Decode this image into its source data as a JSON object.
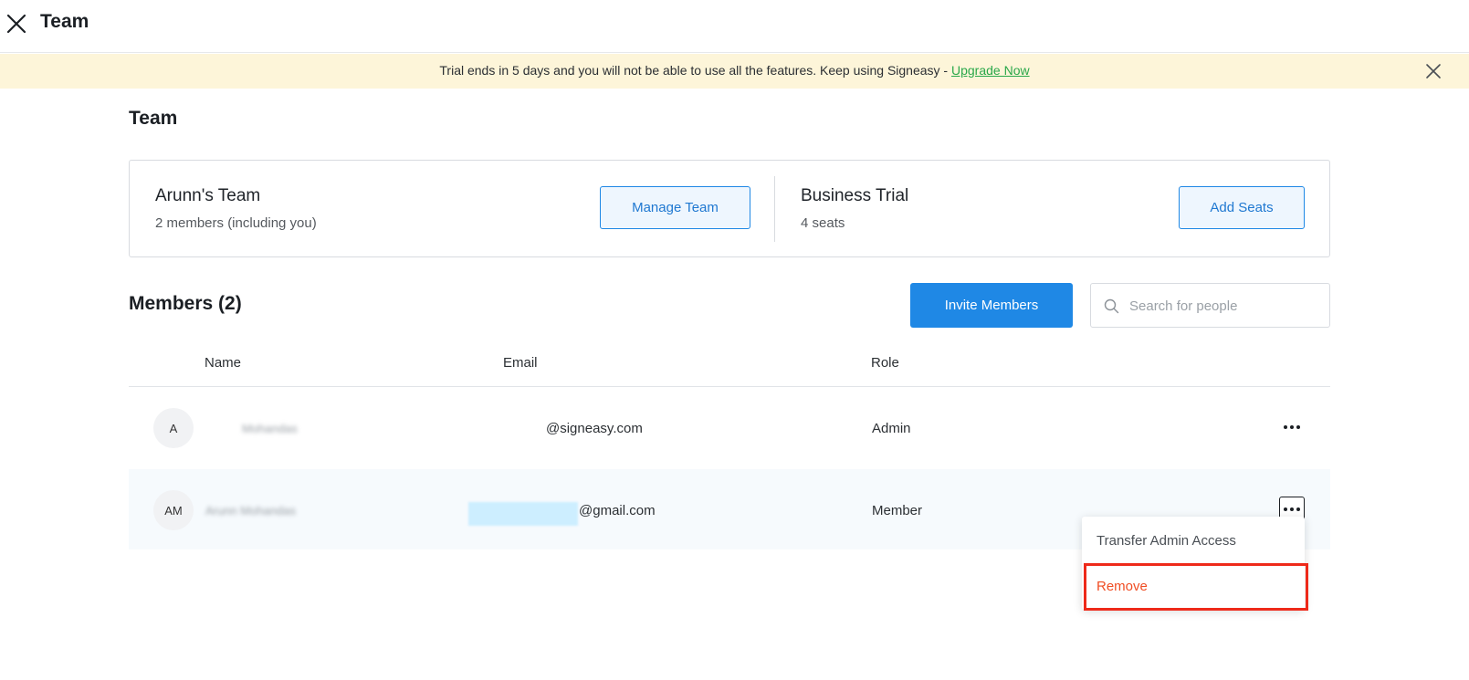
{
  "header": {
    "title": "Team"
  },
  "banner": {
    "text": "Trial ends in 5 days and you will not be able to use all the features. Keep using Signeasy - ",
    "link": "Upgrade Now",
    "link_color": "#2aa84a"
  },
  "page": {
    "section_title": "Team"
  },
  "team_card": {
    "team_name": "Arunn's Team",
    "team_members": "2 members (including you)",
    "manage_label": "Manage Team",
    "plan_name": "Business Trial",
    "plan_seats": "4 seats",
    "add_seats_label": "Add Seats"
  },
  "members": {
    "title": "Members (2)",
    "invite_label": "Invite Members",
    "search_placeholder": "Search for people",
    "columns": {
      "name": "Name",
      "email": "Email",
      "role": "Role"
    },
    "rows": [
      {
        "initials": "A",
        "name": "Mohandas",
        "email": "@signeasy.com",
        "role": "Admin"
      },
      {
        "initials": "AM",
        "name": "Arunn Mohandas",
        "email": "@gmail.com",
        "role": "Member"
      }
    ]
  },
  "menu": {
    "transfer": "Transfer Admin Access",
    "remove": "Remove"
  },
  "colors": {
    "primary": "#1f88e5",
    "banner_bg": "#fdf5d9",
    "remove": "#f04d23",
    "highlight": "#ee2a1a"
  }
}
